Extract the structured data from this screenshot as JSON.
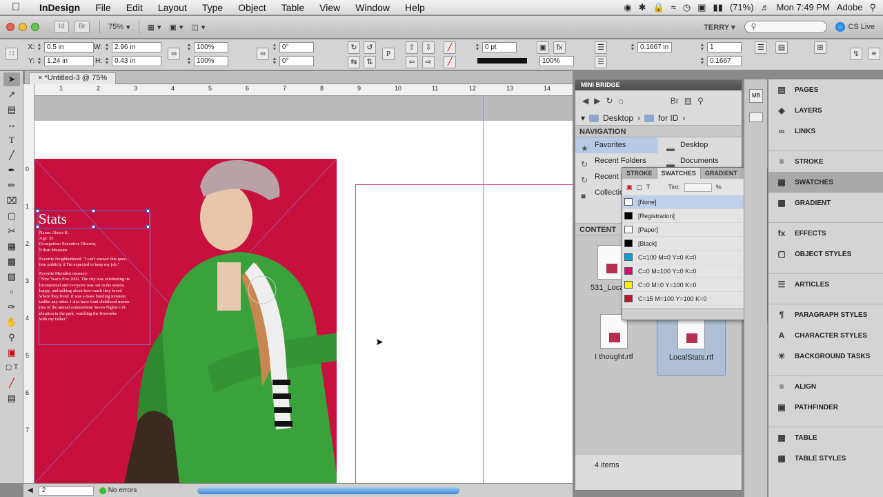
{
  "menubar": {
    "app": "InDesign",
    "items": [
      "File",
      "Edit",
      "Layout",
      "Type",
      "Object",
      "Table",
      "View",
      "Window",
      "Help"
    ],
    "battery": "(71%)",
    "clock": "Mon 7:49 PM",
    "adobe": "Adobe"
  },
  "appbar": {
    "br": "Br",
    "zoom": "75%",
    "workspace": "TERRY",
    "cslive": "CS Live"
  },
  "control": {
    "x": "0.5 in",
    "y": "1.24 in",
    "w": "2.96 in",
    "h": "0.43 in",
    "scale_x": "100%",
    "scale_y": "100%",
    "angle": "0°",
    "shear": "0°",
    "stroke": "0 pt",
    "opacity": "100%",
    "offset1": "0.1667 in",
    "cols": "1",
    "offset2": "0.1667"
  },
  "document": {
    "tab": "*Untitled-3 @ 75%"
  },
  "ruler": {
    "h": [
      "1",
      "2",
      "3",
      "4",
      "5",
      "6",
      "7",
      "8",
      "9",
      "10",
      "11",
      "12",
      "13",
      "14"
    ],
    "v": [
      "0",
      "1",
      "2",
      "3",
      "4",
      "5",
      "6",
      "7"
    ]
  },
  "page": {
    "heading": "Stats",
    "p1": "Name: Alexis K.\nAge: 35\nOccupation: Executive Director,\nUrban Museum",
    "p2": "Favorite Neighborhood: \"I can't answer this ques-\ntion publicly if I'm expected to keep my job.\"",
    "p3": "Favorite Meridien memory:\n\"New Year's Eve 2002. The city was celebrating its\nbicentennial and everyone was out in the streets,\nhappy, and talking about how much they loved\nwhere they lived. It was a mass bonding moment\nunlike any other. I also have fond childhood memo-\nries of the annual summertime Seven Nights Cel-\nebration in the park, watching the fireworks\nwith my father.\""
  },
  "status": {
    "page": "2",
    "errors": "No errors"
  },
  "minibridge": {
    "title": "MINI BRIDGE",
    "crumbs": [
      "Desktop",
      "for ID"
    ],
    "navigation": "NAVIGATION",
    "nav_left": [
      "Favorites",
      "Recent Folders",
      "Recent Files",
      "Collections"
    ],
    "nav_right": [
      "Desktop",
      "Documents"
    ],
    "content": "CONTENT",
    "files": [
      "531_Local...",
      "I thought.rtf",
      "LocalStats.rtf"
    ],
    "count": "4 items"
  },
  "swatches": {
    "tabs": [
      "STROKE",
      "SWATCHES",
      "GRADIENT"
    ],
    "tint_label": "Tint:",
    "pct": "%",
    "rows": [
      {
        "name": "[None]",
        "color": "#ffffff"
      },
      {
        "name": "[Registration]",
        "color": "#000000"
      },
      {
        "name": "[Paper]",
        "color": "#ffffff"
      },
      {
        "name": "[Black]",
        "color": "#000000"
      },
      {
        "name": "C=100 M=0 Y=0 K=0",
        "color": "#00a0e0"
      },
      {
        "name": "C=0 M=100 Y=0 K=0",
        "color": "#e0007a"
      },
      {
        "name": "C=0 M=0 Y=100 K=0",
        "color": "#fff200"
      },
      {
        "name": "C=15 M=100 Y=100 K=0",
        "color": "#c4122f"
      }
    ]
  },
  "dock": {
    "items": [
      "PAGES",
      "LAYERS",
      "LINKS",
      "STROKE",
      "SWATCHES",
      "GRADIENT",
      "EFFECTS",
      "OBJECT STYLES",
      "ARTICLES",
      "PARAGRAPH STYLES",
      "CHARACTER STYLES",
      "BACKGROUND TASKS",
      "ALIGN",
      "PATHFINDER",
      "TABLE",
      "TABLE STYLES"
    ]
  },
  "colors": {
    "page_red": "#c8103e",
    "coat_green": "#3aa23a",
    "guide_blue": "#6aa3dd"
  }
}
